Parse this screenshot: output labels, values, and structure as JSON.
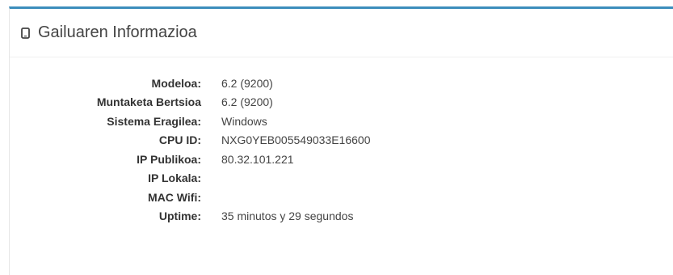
{
  "panel": {
    "title": "Gailuaren Informazioa",
    "icon": "mobile-phone-icon",
    "accent_color": "#3c8dbc"
  },
  "device_info": [
    {
      "label": "Modeloa:",
      "value": "6.2 (9200)"
    },
    {
      "label": "Muntaketa Bertsioa",
      "value": "6.2 (9200)"
    },
    {
      "label": "Sistema Eragilea:",
      "value": "Windows"
    },
    {
      "label": "CPU ID:",
      "value": "NXG0YEB005549033E16600"
    },
    {
      "label": "IP Publikoa:",
      "value": "80.32.101.221"
    },
    {
      "label": "IP Lokala:",
      "value": ""
    },
    {
      "label": "MAC Wifi:",
      "value": ""
    },
    {
      "label": "Uptime:",
      "value": "35 minutos y 29 segundos"
    }
  ]
}
